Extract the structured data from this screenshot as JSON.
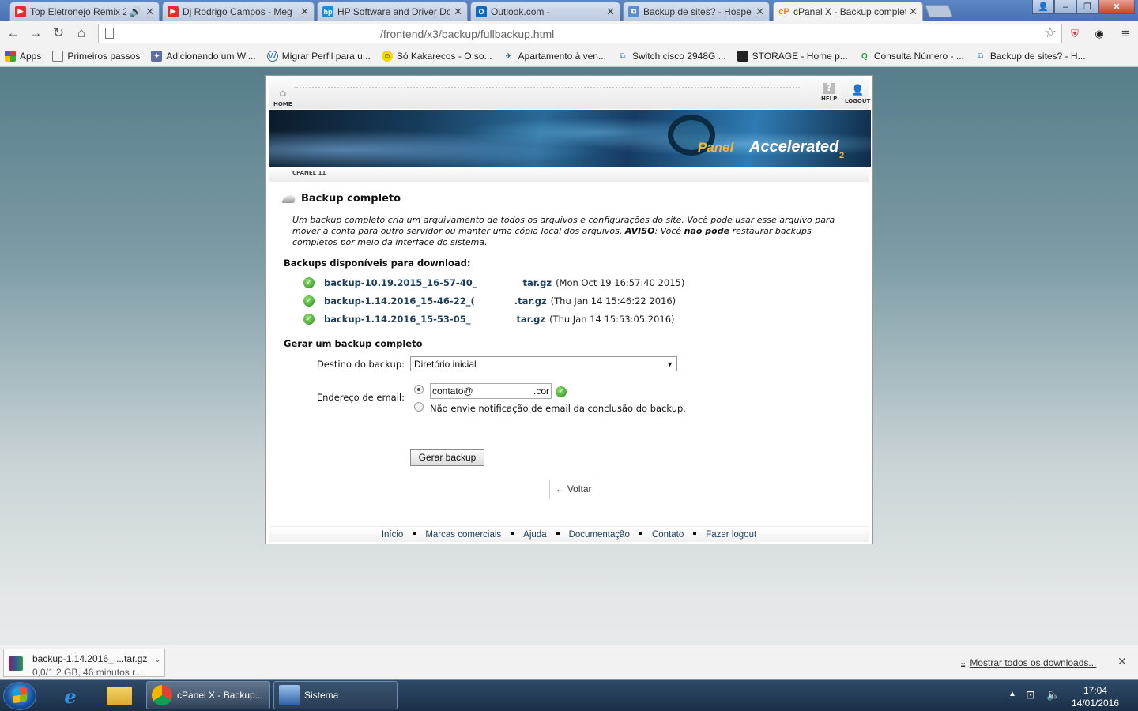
{
  "browser": {
    "tabs": [
      {
        "title": "Top Eletronejo Remix 2",
        "favicon": "youtube-icon"
      },
      {
        "title": "Dj Rodrigo Campos - Meg",
        "favicon": "youtube-icon"
      },
      {
        "title": "HP Software and Driver Do",
        "favicon": "hp-icon"
      },
      {
        "title": "Outlook.com -",
        "favicon": "outlook-icon"
      },
      {
        "title": "Backup de sites? - Hosped",
        "favicon": "link-icon"
      },
      {
        "title": "cPanel X - Backup complet",
        "favicon": "cpanel-icon",
        "active": true
      }
    ],
    "address": "/frontend/x3/backup/fullbackup.html",
    "bookmarks": [
      "Apps",
      "Primeiros passos",
      "Adicionando um Wi...",
      "Migrar Perfil para u...",
      "Só Kakarecos - O so...",
      "Apartamento à ven...",
      "Switch cisco 2948G ...",
      "STORAGE - Home p...",
      "Consulta Número - ...",
      "Backup de sites? - H..."
    ]
  },
  "cpanel": {
    "nav": {
      "home": "HOME",
      "help": "HELP",
      "logout": "LOGOUT"
    },
    "banner": {
      "logo_c": "c",
      "logo_panel": "Panel",
      "logo_accel": "Accelerated",
      "logo_2": "2"
    },
    "version_label": "CPANEL 11",
    "title": "Backup completo",
    "desc": {
      "p1": "Um backup completo cria um arquivamento de todos os arquivos e configurações do site. Você pode usar esse arquivo para mover a conta para outro servidor ou manter uma cópia local dos arquivos. ",
      "aviso": "AVISO",
      "p2": ": Você ",
      "nao_pode": "não pode",
      "p3": " restaurar backups completos por meio da interface do sistema."
    },
    "available_title": "Backups disponíveis para download:",
    "backups": [
      {
        "name": "backup-10.19.2015_16-57-40_",
        "ext": "tar.gz",
        "date": "(Mon Oct 19 16:57:40 2015)"
      },
      {
        "name": "backup-1.14.2016_15-46-22_(",
        "ext": ".tar.gz",
        "date": "(Thu Jan 14 15:46:22 2016)"
      },
      {
        "name": "backup-1.14.2016_15-53-05_",
        "ext": "tar.gz",
        "date": "(Thu Jan 14 15:53:05 2016)"
      }
    ],
    "generate_title": "Gerar um backup completo",
    "dest_label": "Destino do backup:",
    "dest_value": "Diretório inicial",
    "email_label": "Endereço de email:",
    "email_value_left": "contato@",
    "email_value_right": ".cor",
    "no_email_label": "Não envie notificação de email da conclusão do backup.",
    "generate_button": "Gerar backup",
    "back_link": "← Voltar",
    "footer": [
      "Início",
      "Marcas comerciais",
      "Ajuda",
      "Documentação",
      "Contato",
      "Fazer logout"
    ]
  },
  "downloads": {
    "file": "backup-1.14.2016_....tar.gz",
    "status": "0,0/1,2 GB, 46 minutos r...",
    "show_all": "Mostrar todos os downloads..."
  },
  "taskbar": {
    "tasks": [
      {
        "label": "cPanel X - Backup...",
        "icon": "chrome-icon"
      },
      {
        "label": "Sistema",
        "icon": "system-icon"
      }
    ],
    "time": "17:04",
    "date": "14/01/2016"
  },
  "colors": {
    "link": "#1c3d5a",
    "check_green": "#2e8b1e"
  }
}
